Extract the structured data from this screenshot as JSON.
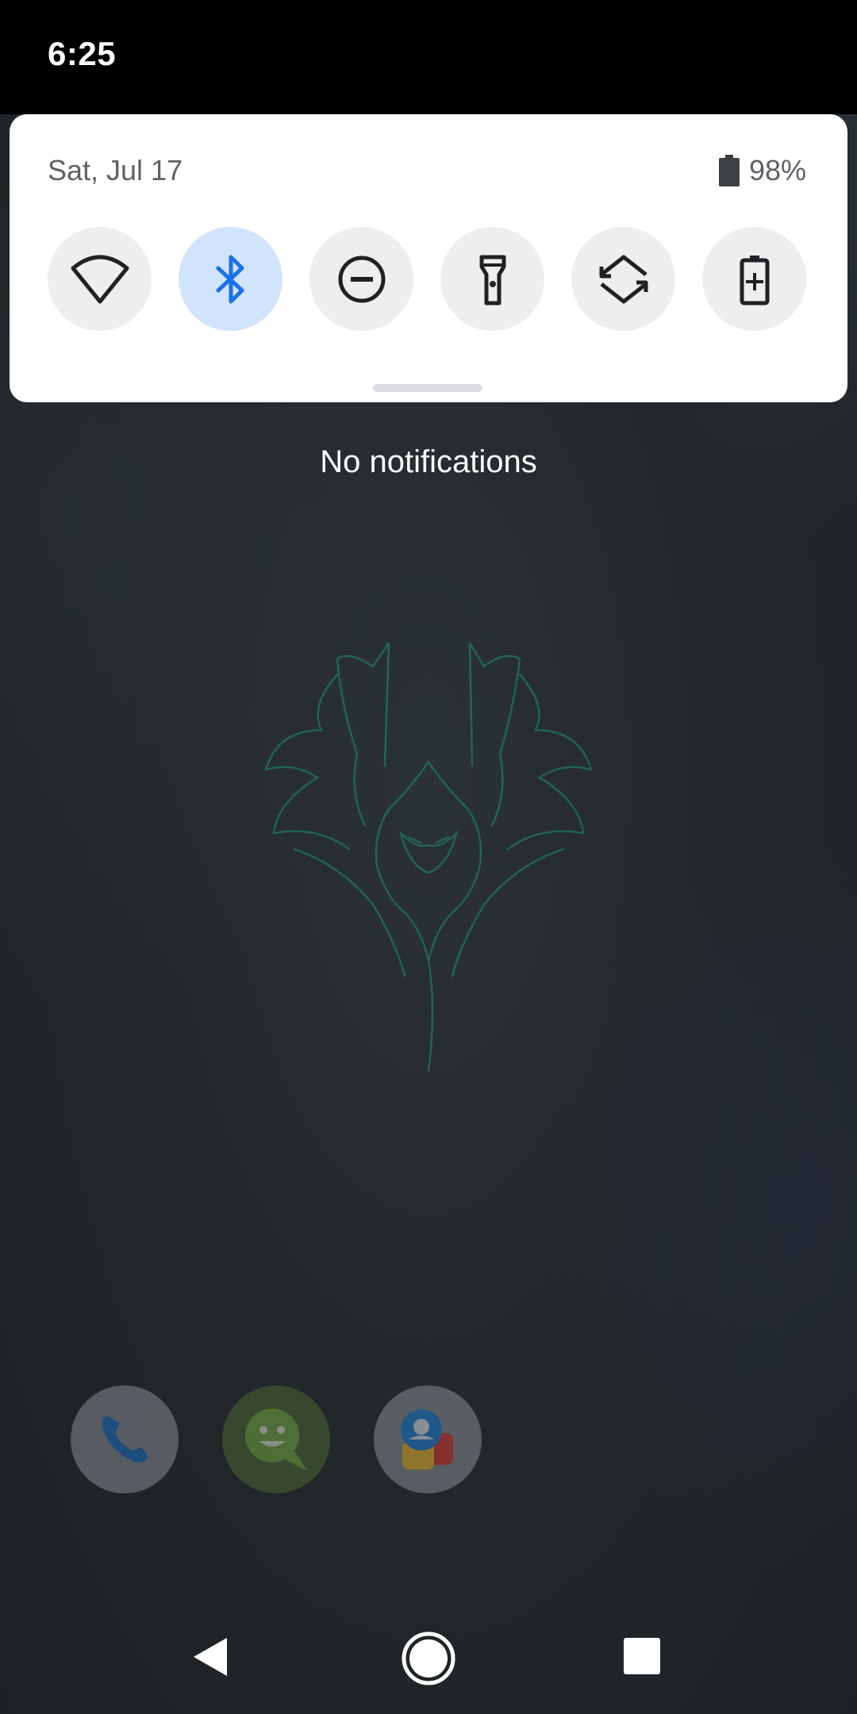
{
  "status_bar": {
    "time": "6:25"
  },
  "quick_settings": {
    "date": "Sat, Jul 17",
    "battery_percent": "98%",
    "tiles": [
      {
        "icon": "wifi-icon",
        "active": false
      },
      {
        "icon": "bluetooth-icon",
        "active": true
      },
      {
        "icon": "do-not-disturb-icon",
        "active": false
      },
      {
        "icon": "flashlight-icon",
        "active": false
      },
      {
        "icon": "auto-rotate-icon",
        "active": false
      },
      {
        "icon": "battery-saver-icon",
        "active": false
      }
    ],
    "colors": {
      "panel": "#ffffff",
      "tile_inactive": "#eeeeee",
      "tile_active": "#d2e3fc",
      "accent": "#1a73e8",
      "icon": "#202124"
    }
  },
  "notifications": {
    "empty_text": "No notifications"
  },
  "dock": {
    "apps": [
      {
        "icon": "phone-app-icon"
      },
      {
        "icon": "messages-app-icon"
      },
      {
        "icon": "duo-app-icon"
      }
    ]
  },
  "navigation": {
    "buttons": [
      "back-icon",
      "home-icon",
      "recents-icon"
    ]
  }
}
